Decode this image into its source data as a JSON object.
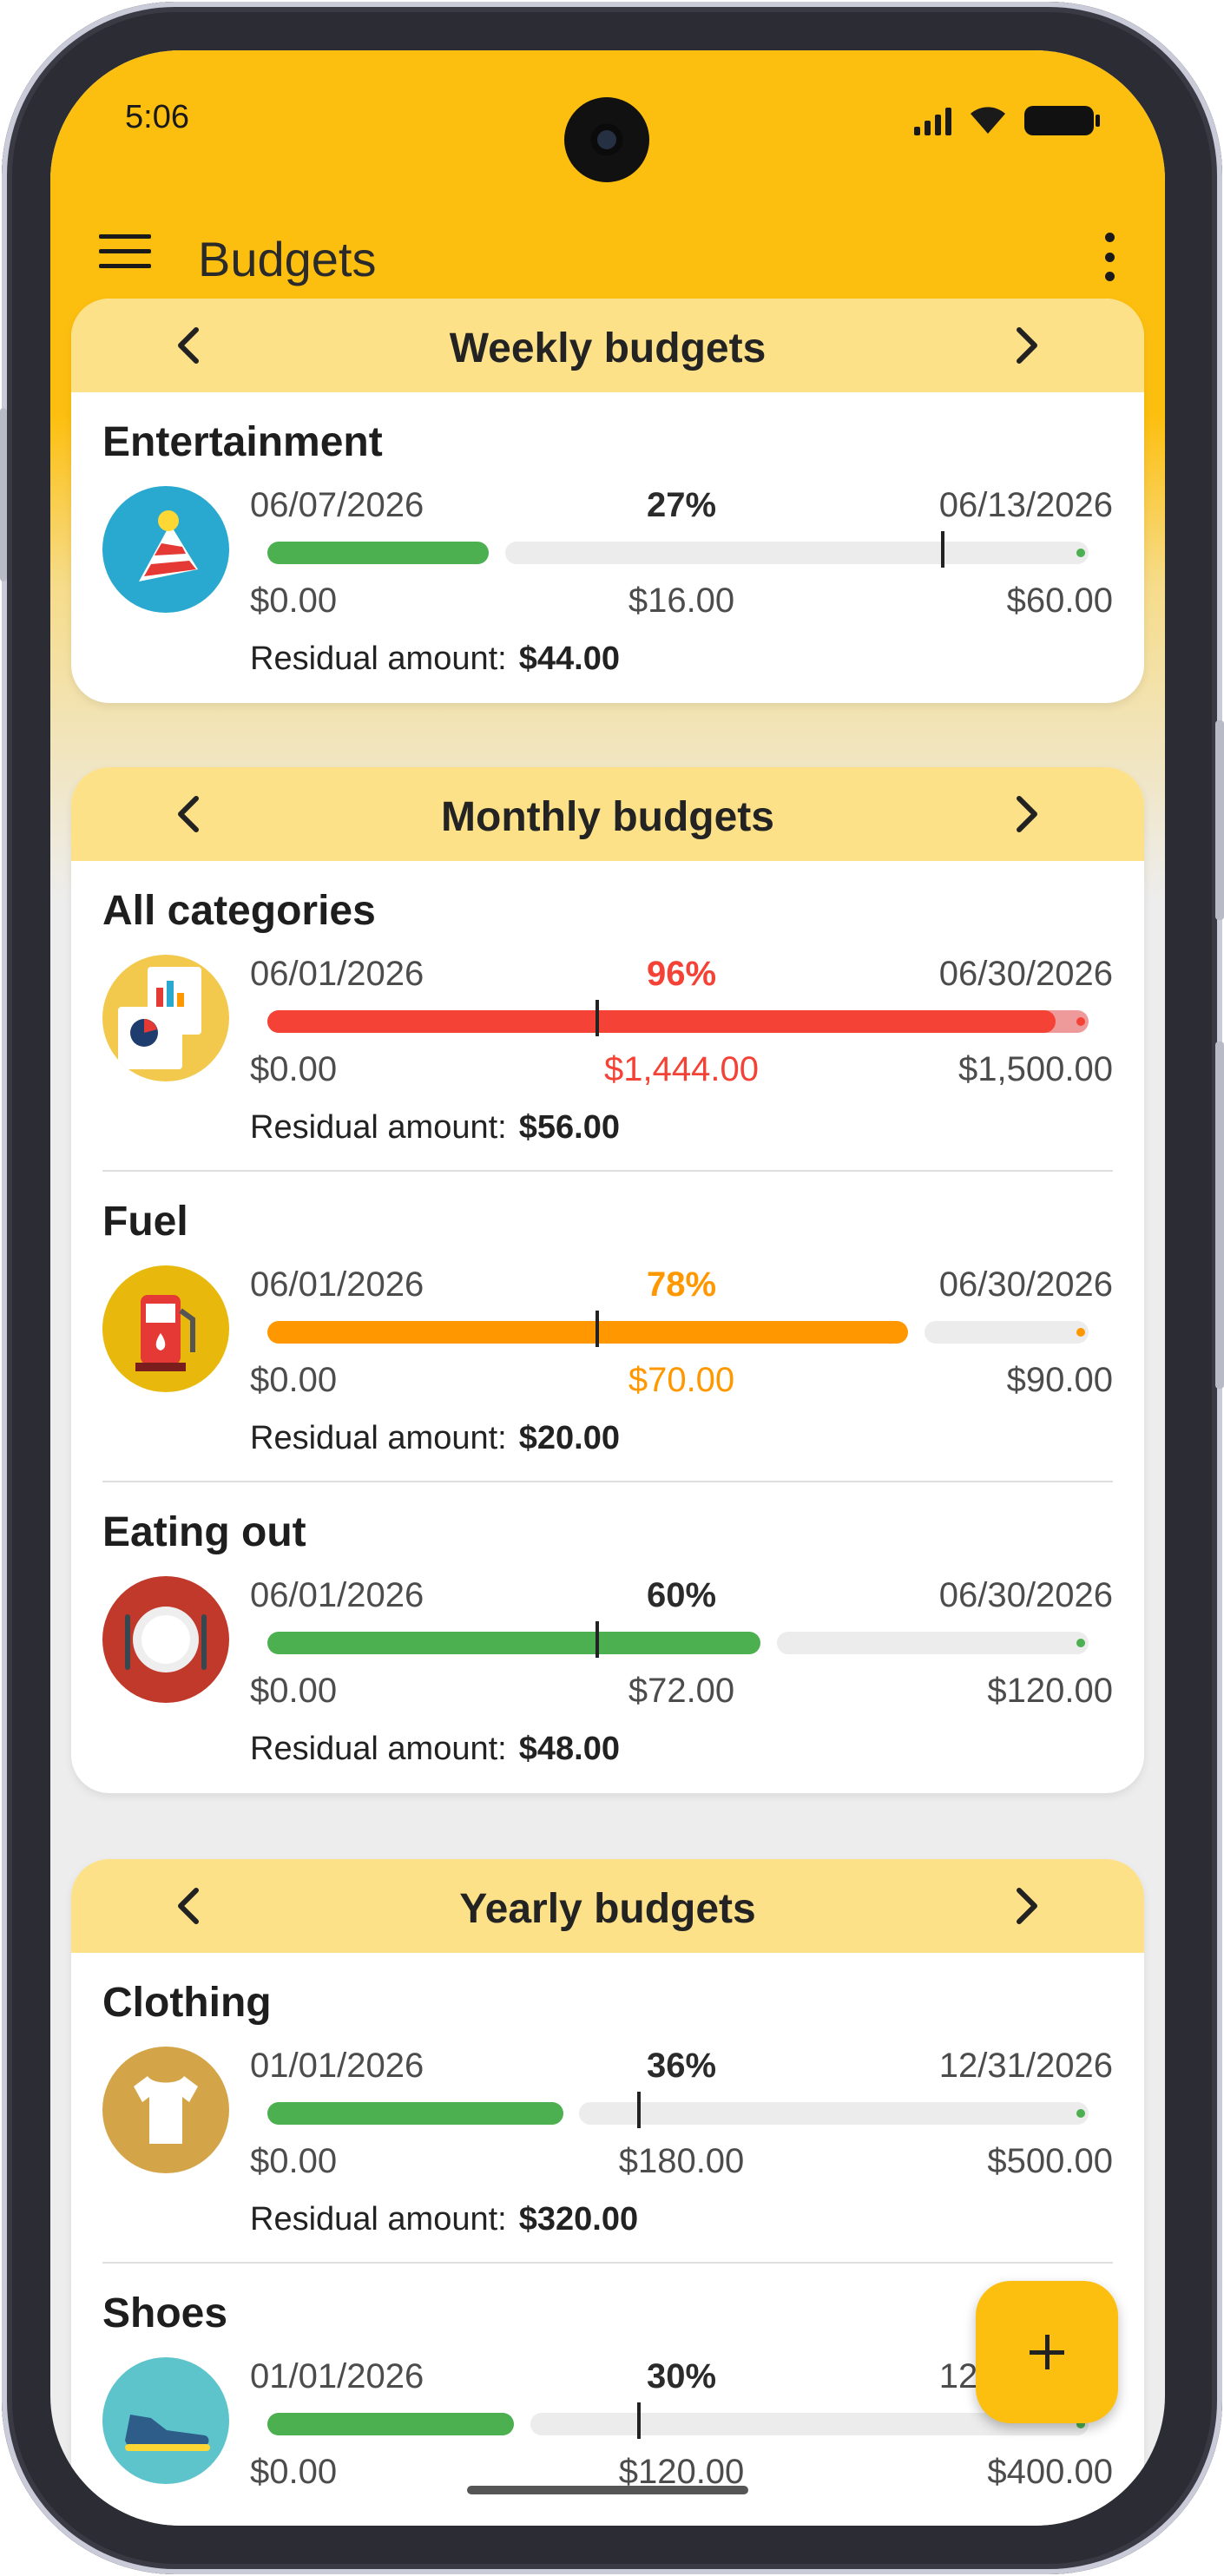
{
  "status": {
    "time": "5:06"
  },
  "app": {
    "title": "Budgets"
  },
  "colors": {
    "accent": "#fdbf0f",
    "header": "#fde189",
    "green": "#4caf50",
    "orange": "#ff9800",
    "red": "#f44336"
  },
  "fab": {
    "icon": "plus-icon"
  },
  "sections": [
    {
      "title": "Weekly budgets",
      "items": [
        {
          "name": "Entertainment",
          "icon": "party-hat-icon",
          "start": "06/07/2026",
          "end": "06/13/2026",
          "percent": "27%",
          "min": "$0.00",
          "spent": "$16.00",
          "max": "$60.00",
          "residual_label": "Residual amount:",
          "residual": "$44.00",
          "fill_fraction": 0.27,
          "marker_fraction": 0.82,
          "status": "green"
        }
      ]
    },
    {
      "title": "Monthly budgets",
      "items": [
        {
          "name": "All categories",
          "icon": "reports-icon",
          "start": "06/01/2026",
          "end": "06/30/2026",
          "percent": "96%",
          "min": "$0.00",
          "spent": "$1,444.00",
          "max": "$1,500.00",
          "residual_label": "Residual amount:",
          "residual": "$56.00",
          "fill_fraction": 0.96,
          "marker_fraction": 0.4,
          "status": "red"
        },
        {
          "name": "Fuel",
          "icon": "fuel-pump-icon",
          "start": "06/01/2026",
          "end": "06/30/2026",
          "percent": "78%",
          "min": "$0.00",
          "spent": "$70.00",
          "max": "$90.00",
          "residual_label": "Residual amount:",
          "residual": "$20.00",
          "fill_fraction": 0.78,
          "marker_fraction": 0.4,
          "status": "orange"
        },
        {
          "name": "Eating out",
          "icon": "plate-cutlery-icon",
          "start": "06/01/2026",
          "end": "06/30/2026",
          "percent": "60%",
          "min": "$0.00",
          "spent": "$72.00",
          "max": "$120.00",
          "residual_label": "Residual amount:",
          "residual": "$48.00",
          "fill_fraction": 0.6,
          "marker_fraction": 0.4,
          "status": "green"
        }
      ]
    },
    {
      "title": "Yearly budgets",
      "items": [
        {
          "name": "Clothing",
          "icon": "tshirt-icon",
          "start": "01/01/2026",
          "end": "12/31/2026",
          "percent": "36%",
          "min": "$0.00",
          "spent": "$180.00",
          "max": "$500.00",
          "residual_label": "Residual amount:",
          "residual": "$320.00",
          "fill_fraction": 0.36,
          "marker_fraction": 0.45,
          "status": "green"
        },
        {
          "name": "Shoes",
          "icon": "sneaker-icon",
          "start": "01/01/2026",
          "end": "12/31/2026",
          "percent": "30%",
          "min": "$0.00",
          "spent": "$120.00",
          "max": "$400.00",
          "residual_label": "",
          "residual": "",
          "fill_fraction": 0.3,
          "marker_fraction": 0.45,
          "status": "green"
        }
      ]
    }
  ]
}
